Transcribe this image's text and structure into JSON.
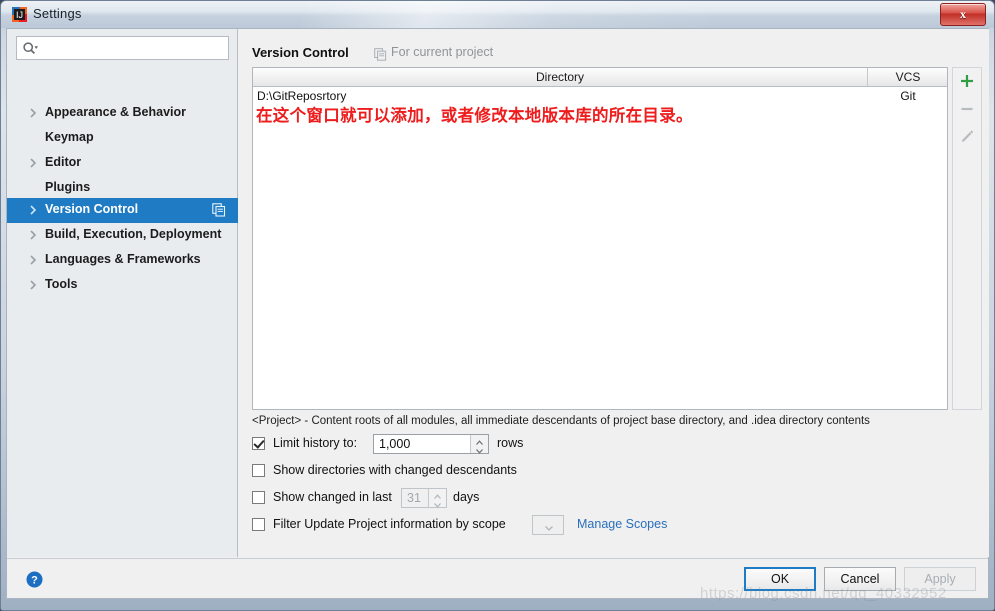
{
  "window": {
    "title": "Settings",
    "app_icon": "intellij-idea-icon",
    "close_label": "x"
  },
  "search": {
    "value": "",
    "placeholder": "",
    "icon": "search-icon"
  },
  "sidebar": {
    "items": [
      {
        "label": "Appearance & Behavior",
        "expandable": true,
        "selected": false
      },
      {
        "label": "Keymap",
        "expandable": false,
        "selected": false
      },
      {
        "label": "Editor",
        "expandable": true,
        "selected": false
      },
      {
        "label": "Plugins",
        "expandable": false,
        "selected": false
      },
      {
        "label": "Version Control",
        "expandable": true,
        "selected": true
      },
      {
        "label": "Build, Execution, Deployment",
        "expandable": true,
        "selected": false
      },
      {
        "label": "Languages & Frameworks",
        "expandable": true,
        "selected": false
      },
      {
        "label": "Tools",
        "expandable": true,
        "selected": false
      }
    ]
  },
  "panel": {
    "title": "Version Control",
    "scope_label": "For current project",
    "scope_icon": "copy-icon"
  },
  "table": {
    "columns": [
      "Directory",
      "VCS"
    ],
    "rows": [
      {
        "directory": "D:\\GitReposrtory",
        "vcs": "Git"
      }
    ],
    "annotation": "在这个窗口就可以添加，或者修改本地版本库的所在目录。",
    "annotation_color": "#ee1c1c"
  },
  "toolbar": {
    "add_label": "+",
    "remove_label": "−",
    "edit_label": "edit"
  },
  "hint": "<Project> - Content roots of all modules, all immediate descendants of project base directory, and .idea directory contents",
  "options": [
    {
      "label": "Limit history to:",
      "checked": true,
      "value": "1,000",
      "suffix": "rows"
    },
    {
      "label": "Show directories with changed descendants",
      "checked": false
    },
    {
      "label": "Show changed in last",
      "checked": false,
      "value": "31",
      "suffix": "days"
    },
    {
      "label": "Filter Update Project information by scope",
      "checked": false,
      "combo_value": "",
      "link": "Manage Scopes"
    }
  ],
  "footer": {
    "help": "?",
    "ok": "OK",
    "cancel": "Cancel",
    "apply": "Apply"
  },
  "watermark": "https://blog.csdn.net/qq_40332952"
}
